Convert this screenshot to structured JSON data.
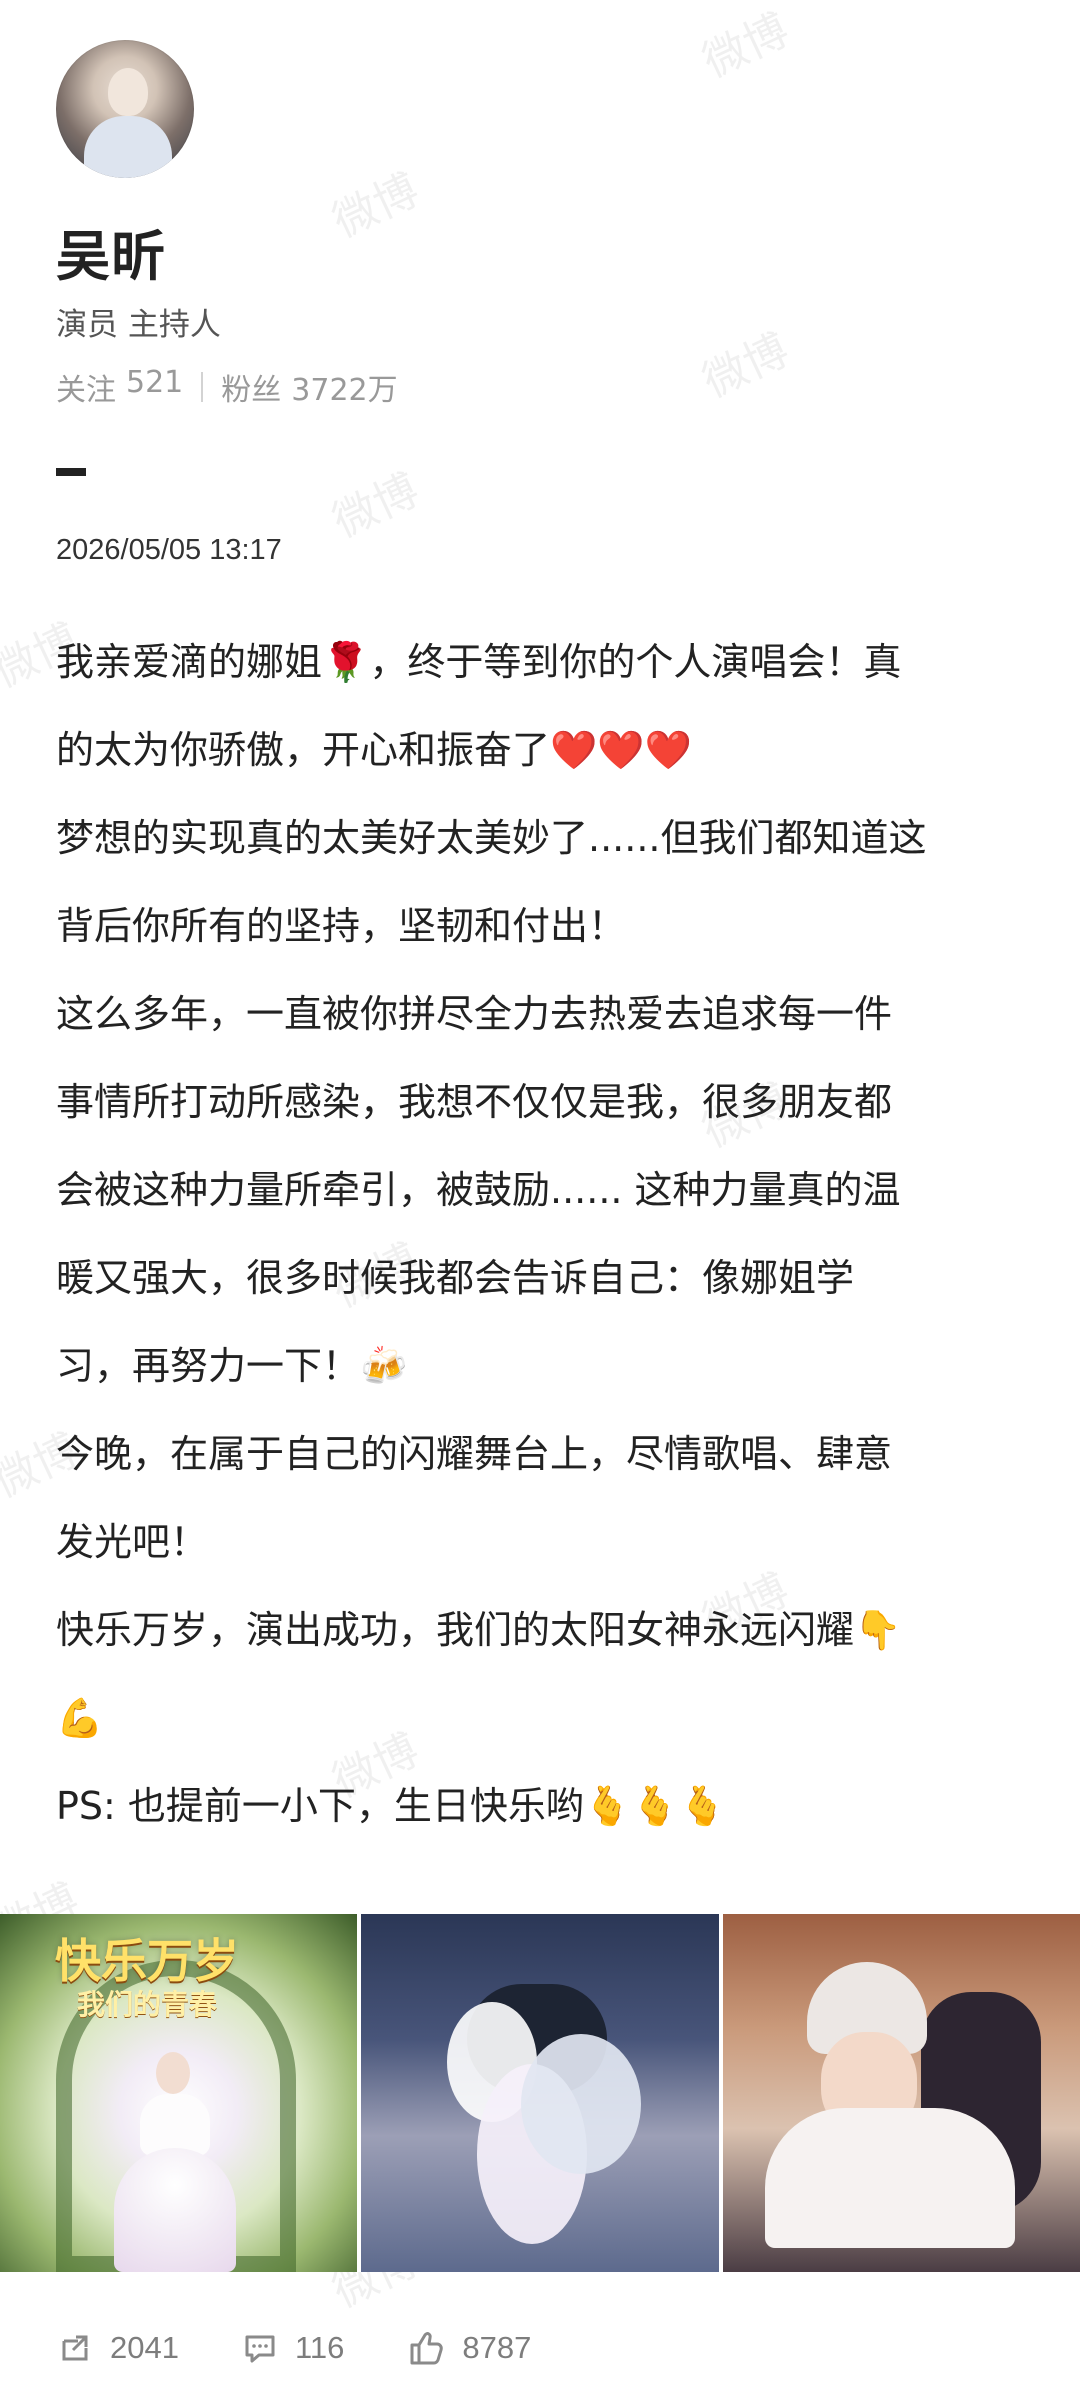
{
  "profile": {
    "name": "吴昕",
    "title": "演员 主持人",
    "following_label": "关注",
    "following_count": "521",
    "followers_label": "粉丝",
    "followers_count": "3722万"
  },
  "post": {
    "timestamp": "2026/05/05 13:17",
    "lines": [
      "我亲爱滴的娜姐🌹，终于等到你的个人演唱会！真",
      "的太为你骄傲，开心和振奋了❤️❤️❤️",
      "梦想的实现真的太美好太美妙了......但我们都知道这",
      "背后你所有的坚持，坚韧和付出！",
      "这么多年，一直被你拼尽全力去热爱去追求每一件",
      "事情所打动所感染，我想不仅仅是我，很多朋友都",
      "会被这种力量所牵引，被鼓励...... 这种力量真的温",
      "暖又强大，很多时候我都会告诉自己：像娜姐学",
      "习，再努力一下！🍻",
      "今晚，在属于自己的闪耀舞台上，尽情歌唱、肆意",
      "发光吧！",
      "快乐万岁，演出成功，我们的太阳女神永远闪耀👇",
      "💪",
      "PS: 也提前一小下，生日快乐哟🫰🫰🫰"
    ],
    "image_1_title": "快乐万岁",
    "image_1_subtitle": "我们的青春"
  },
  "actions": {
    "repost_count": "2041",
    "comment_count": "116",
    "like_count": "8787"
  },
  "watermark": {
    "text": "微博"
  },
  "colors": {
    "text_primary": "#222222",
    "text_secondary": "#555555",
    "text_muted": "#999999",
    "divider": "#d3d3d3",
    "action_gray": "#7d7d7d"
  }
}
